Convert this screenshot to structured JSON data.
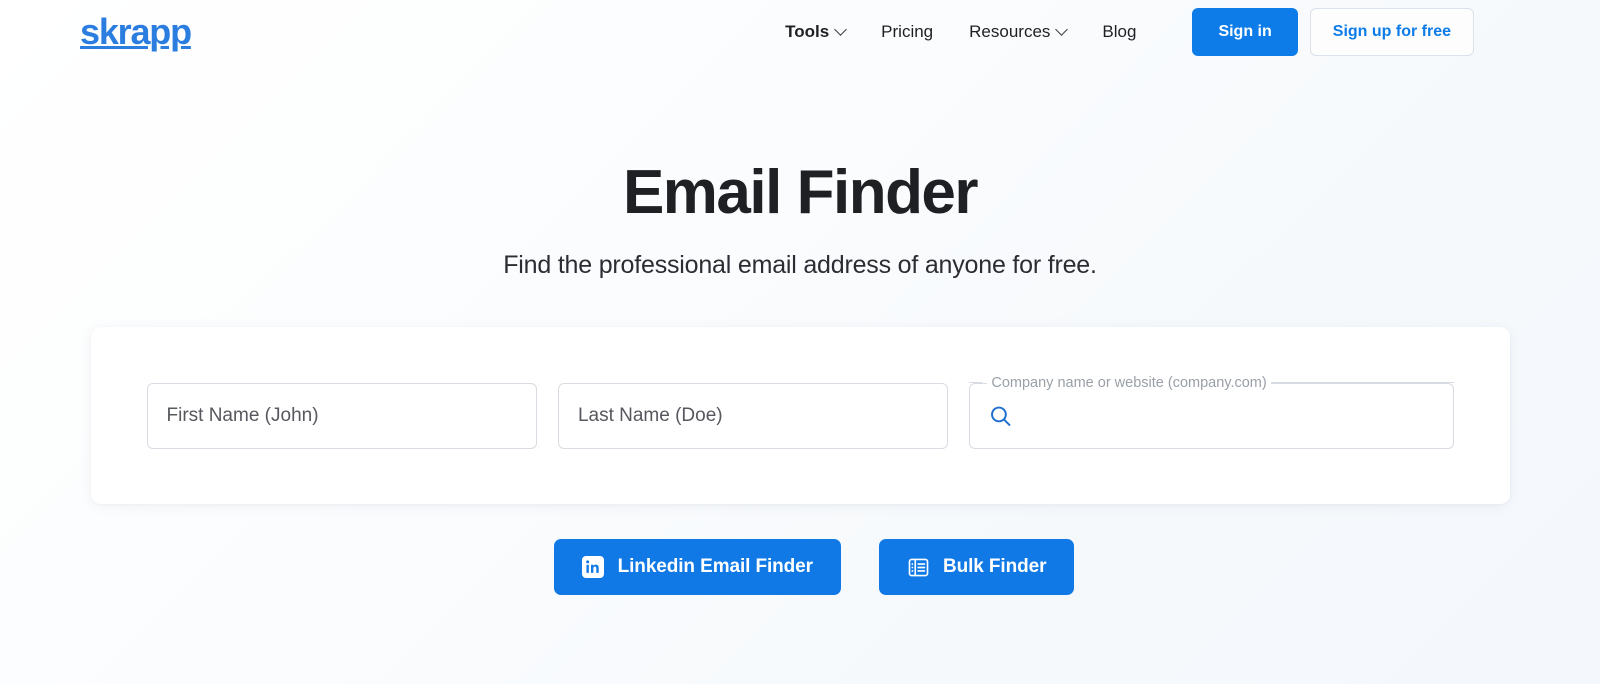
{
  "brand": {
    "name": "skrapp"
  },
  "nav": {
    "items": [
      {
        "label": "Tools",
        "has_dropdown": true,
        "active": true
      },
      {
        "label": "Pricing",
        "has_dropdown": false,
        "active": false
      },
      {
        "label": "Resources",
        "has_dropdown": true,
        "active": false
      },
      {
        "label": "Blog",
        "has_dropdown": false,
        "active": false
      }
    ]
  },
  "header_actions": {
    "sign_in_label": "Sign in",
    "sign_up_label": "Sign up for free"
  },
  "hero": {
    "title": "Email Finder",
    "subtitle": "Find the professional email address of anyone for free."
  },
  "search_form": {
    "first_name": {
      "placeholder": "First Name (John)",
      "value": ""
    },
    "last_name": {
      "placeholder": "Last Name (Doe)",
      "value": ""
    },
    "company": {
      "label": "Company name or website (company.com)",
      "placeholder": "",
      "value": ""
    }
  },
  "cta": {
    "linkedin_label": "Linkedin Email Finder",
    "bulk_label": "Bulk Finder"
  },
  "colors": {
    "brand_blue": "#2b7de0",
    "button_blue": "#0d7ce8",
    "cta_blue": "#1179e6",
    "page_background": "#f8fafd",
    "card_background": "#ffffff",
    "heading_text": "#1f2024",
    "field_border": "#d8dce2",
    "label_muted": "#9aa0a8"
  }
}
